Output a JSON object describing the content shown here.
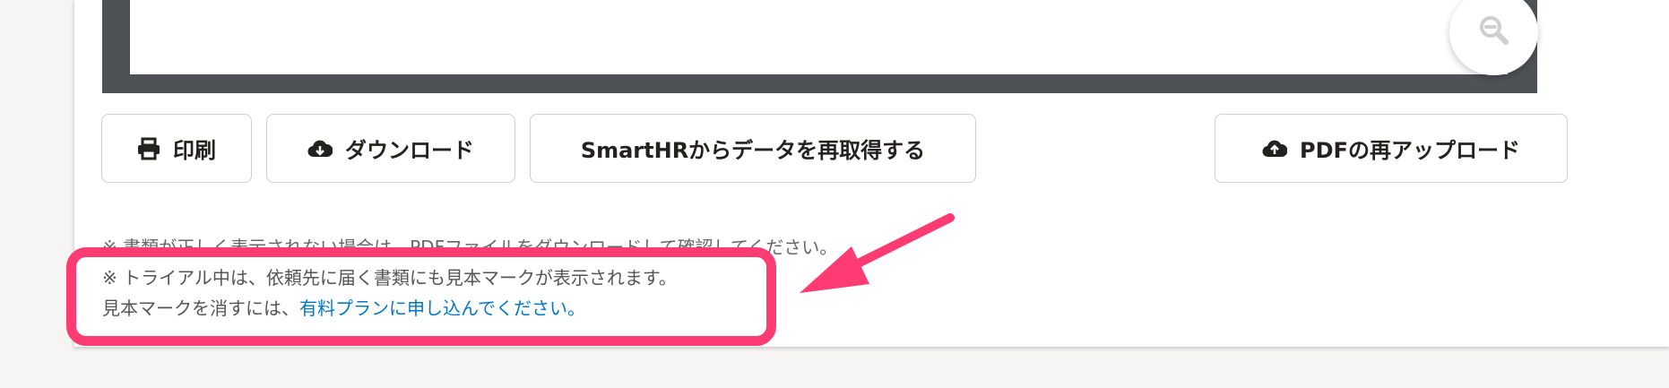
{
  "toolbar": {
    "print_label": "印刷",
    "download_label": "ダウンロード",
    "refetch_label": "SmartHRからデータを再取得する",
    "reupload_label": "PDFの再アップロード"
  },
  "notices": {
    "display_notice": "※ 書類が正しく表示されない場合は、PDFファイルをダウンロードして確認してください。",
    "trial_line1": "※ トライアル中は、依頼先に届く書類にも見本マークが表示されます。",
    "trial_line2_prefix": "見本マークを消すには、",
    "trial_line2_link": "有料プランに申し込んでください。"
  },
  "icons": {
    "zoom": "zoom-out-icon",
    "print": "printer-icon",
    "download": "cloud-download-icon",
    "upload": "cloud-upload-icon"
  },
  "colors": {
    "highlight": "#ff3b74",
    "link": "#0077c7",
    "viewer_frame": "#4e5256"
  }
}
